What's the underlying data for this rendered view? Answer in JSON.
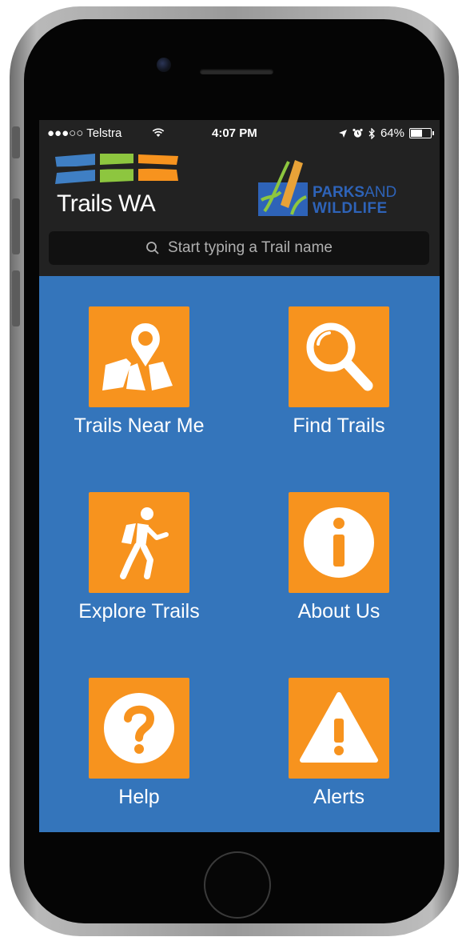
{
  "status_bar": {
    "carrier": "●●●○○ Telstra",
    "time": "4:07 PM",
    "battery": "64%",
    "battery_level": 0.64
  },
  "header": {
    "app_logo_text": "Trails WA",
    "partner_logo_text_bold": "PARKS",
    "partner_logo_text_thin": "AND",
    "partner_logo_text_line2": "WILDLIFE"
  },
  "search": {
    "placeholder": "Start typing a Trail name"
  },
  "menu": [
    {
      "label": "Trails Near Me",
      "icon": "map-pin-icon"
    },
    {
      "label": "Find Trails",
      "icon": "magnifier-icon"
    },
    {
      "label": "Explore Trails",
      "icon": "hiker-icon"
    },
    {
      "label": "About Us",
      "icon": "info-icon"
    },
    {
      "label": "Help",
      "icon": "question-icon"
    },
    {
      "label": "Alerts",
      "icon": "warning-icon"
    }
  ],
  "colors": {
    "background": "#3475bb",
    "tile": "#f7931e",
    "header": "#222222"
  }
}
